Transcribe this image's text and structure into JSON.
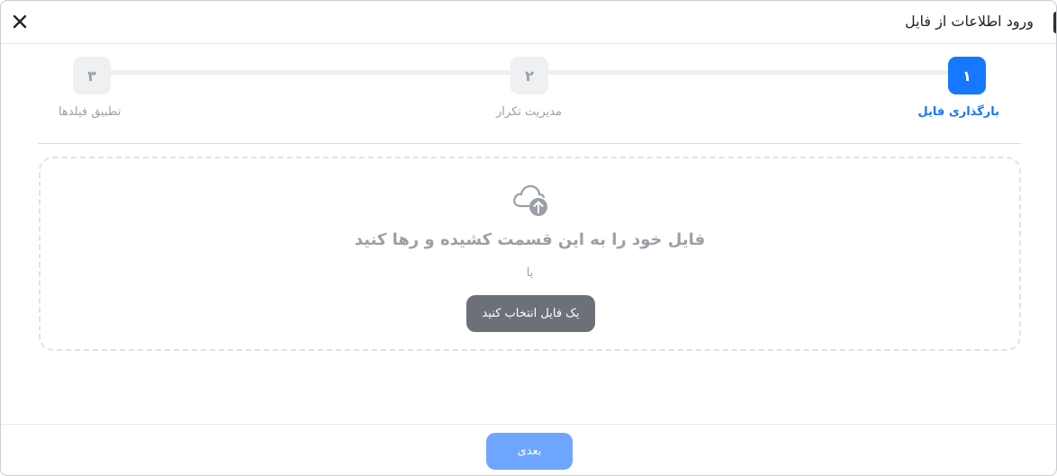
{
  "dialog": {
    "title": "ورود اطلاعات از فایل",
    "close_glyph": "✕"
  },
  "stepper": {
    "steps": [
      {
        "number": "۱",
        "label": "بارگذاری فایل",
        "state": "active"
      },
      {
        "number": "۲",
        "label": "مدیریت تکرار",
        "state": "inactive"
      },
      {
        "number": "۳",
        "label": "تطبیق فیلدها",
        "state": "inactive"
      }
    ]
  },
  "dropzone": {
    "icon": "cloud-upload-icon",
    "title": "فایل خود را به این قسمت کشیده و رها کنید",
    "or_text": "یا",
    "choose_button": "یک فایل انتخاب کنید"
  },
  "footer": {
    "next_button": "بعدی"
  },
  "colors": {
    "accent": "#1677ff",
    "accent_disabled": "#6ea6ff",
    "muted_text": "#9aa0a6",
    "choose_button_bg": "#6c7178"
  }
}
